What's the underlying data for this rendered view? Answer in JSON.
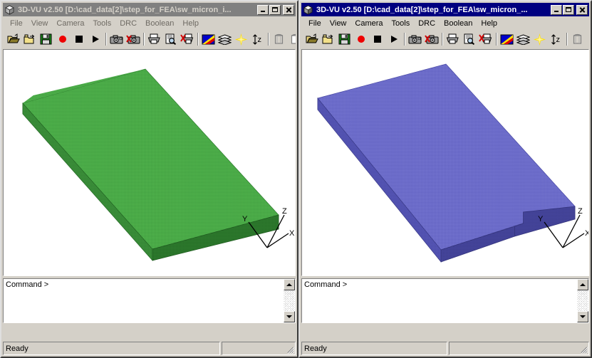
{
  "app": {
    "name": "3D-VU",
    "version": "v2.50"
  },
  "windows": [
    {
      "id": "left",
      "active": false,
      "title": "3D-VU v2.50 [D:\\cad_data[2]\\step_for_FEA\\sw_micron_i...",
      "app_icon": "cube-icon",
      "menu": [
        "File",
        "View",
        "Camera",
        "Tools",
        "DRC",
        "Boolean",
        "Help"
      ],
      "titlebar_buttons": [
        {
          "name": "minimize-button",
          "glyph": "minimize-icon"
        },
        {
          "name": "maximize-button",
          "glyph": "maximize-icon"
        },
        {
          "name": "close-button",
          "glyph": "close-icon"
        }
      ],
      "toolbar": [
        {
          "name": "open-file-button",
          "icon": "open-folder-icon"
        },
        {
          "name": "new-folder-button",
          "icon": "folder-new-icon"
        },
        {
          "name": "save-button",
          "icon": "floppy-save-icon"
        },
        {
          "name": "record-button",
          "icon": "record-circle-icon"
        },
        {
          "name": "stop-button",
          "icon": "stop-square-icon"
        },
        {
          "name": "play-button",
          "icon": "play-triangle-icon"
        },
        {
          "name": "separator-1",
          "icon": "separator"
        },
        {
          "name": "snapshot-button",
          "icon": "camera-icon"
        },
        {
          "name": "snapshot-delete-button",
          "icon": "camera-delete-icon"
        },
        {
          "name": "separator-2",
          "icon": "separator"
        },
        {
          "name": "print-button",
          "icon": "printer-icon"
        },
        {
          "name": "print-preview-button",
          "icon": "print-preview-icon"
        },
        {
          "name": "print-cancel-button",
          "icon": "print-cancel-icon"
        },
        {
          "name": "separator-3",
          "icon": "separator"
        },
        {
          "name": "color-button",
          "icon": "color-palette-icon"
        },
        {
          "name": "layers-button",
          "icon": "layers-icon"
        },
        {
          "name": "light-button",
          "icon": "light-star-icon"
        },
        {
          "name": "z-extent-button",
          "icon": "z-arrow-icon"
        },
        {
          "name": "separator-4",
          "icon": "separator"
        },
        {
          "name": "box-view-button",
          "icon": "bounding-box-icon"
        },
        {
          "name": "extra-button",
          "icon": "clipped-icon"
        }
      ],
      "viewport": {
        "name": "model-viewport",
        "model_color": "#45a544",
        "model_color_dark": "#2e8b2e",
        "background": "#ffffff",
        "axes": {
          "labels": [
            "X",
            "Y",
            "Z"
          ]
        }
      },
      "command": {
        "prompt": "Command >",
        "value": ""
      },
      "status": {
        "left": "Ready",
        "right": ""
      }
    },
    {
      "id": "right",
      "active": true,
      "title": "3D-VU v2.50 [D:\\cad_data[2]\\step_for_FEA\\sw_micron_...",
      "app_icon": "cube-icon",
      "menu": [
        "File",
        "View",
        "Camera",
        "Tools",
        "DRC",
        "Boolean",
        "Help"
      ],
      "titlebar_buttons": [
        {
          "name": "minimize-button",
          "glyph": "minimize-icon"
        },
        {
          "name": "maximize-button",
          "glyph": "maximize-icon"
        },
        {
          "name": "close-button",
          "glyph": "close-icon"
        }
      ],
      "toolbar": [
        {
          "name": "open-file-button",
          "icon": "open-folder-icon"
        },
        {
          "name": "new-folder-button",
          "icon": "folder-new-icon"
        },
        {
          "name": "save-button",
          "icon": "floppy-save-icon"
        },
        {
          "name": "record-button",
          "icon": "record-circle-icon"
        },
        {
          "name": "stop-button",
          "icon": "stop-square-icon"
        },
        {
          "name": "play-button",
          "icon": "play-triangle-icon"
        },
        {
          "name": "separator-1",
          "icon": "separator"
        },
        {
          "name": "snapshot-button",
          "icon": "camera-icon"
        },
        {
          "name": "snapshot-delete-button",
          "icon": "camera-delete-icon"
        },
        {
          "name": "separator-2",
          "icon": "separator"
        },
        {
          "name": "print-button",
          "icon": "printer-icon"
        },
        {
          "name": "print-preview-button",
          "icon": "print-preview-icon"
        },
        {
          "name": "print-cancel-button",
          "icon": "print-cancel-icon"
        },
        {
          "name": "separator-3",
          "icon": "separator"
        },
        {
          "name": "color-button",
          "icon": "color-palette-icon"
        },
        {
          "name": "layers-button",
          "icon": "layers-icon"
        },
        {
          "name": "light-button",
          "icon": "light-star-icon"
        },
        {
          "name": "z-extent-button",
          "icon": "z-arrow-icon"
        },
        {
          "name": "separator-4",
          "icon": "separator"
        },
        {
          "name": "box-view-button",
          "icon": "bounding-box-icon"
        }
      ],
      "viewport": {
        "name": "model-viewport",
        "model_color": "#6a6ac8",
        "model_color_dark": "#4a4aa0",
        "background": "#ffffff",
        "axes": {
          "labels": [
            "X",
            "Y",
            "Z"
          ]
        }
      },
      "command": {
        "prompt": "Command >",
        "value": ""
      },
      "status": {
        "left": "Ready",
        "right": ""
      }
    }
  ]
}
